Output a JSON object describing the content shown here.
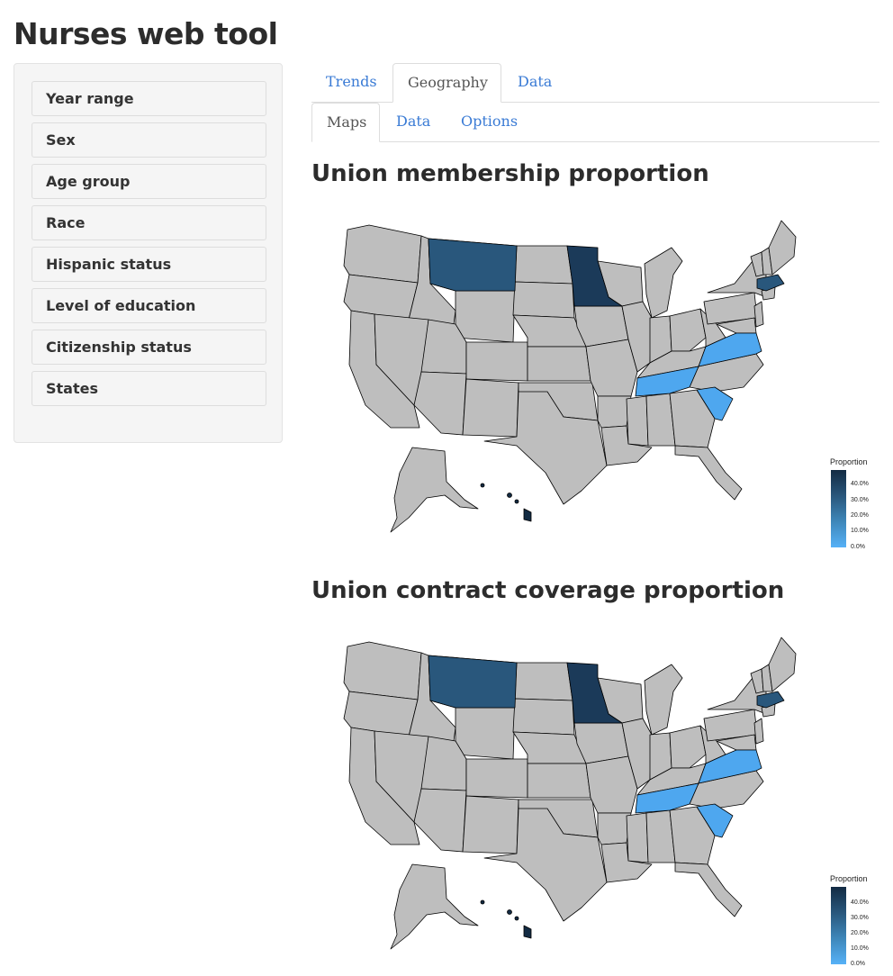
{
  "app": {
    "title": "Nurses web tool"
  },
  "sidebar": {
    "items": [
      {
        "label": "Year range"
      },
      {
        "label": "Sex"
      },
      {
        "label": "Age group"
      },
      {
        "label": "Race"
      },
      {
        "label": "Hispanic status"
      },
      {
        "label": "Level of education"
      },
      {
        "label": "Citizenship status"
      },
      {
        "label": "States"
      }
    ]
  },
  "main_tabs": [
    {
      "label": "Trends",
      "active": false
    },
    {
      "label": "Geography",
      "active": true
    },
    {
      "label": "Data",
      "active": false
    }
  ],
  "sub_tabs": [
    {
      "label": "Maps",
      "active": true
    },
    {
      "label": "Data",
      "active": false
    },
    {
      "label": "Options",
      "active": false
    }
  ],
  "colors": {
    "link": "#3a7bd5",
    "no_data": "#bebebe",
    "low": "#56b1f7",
    "high": "#132b43"
  },
  "maps": [
    {
      "title": "Union membership proportion",
      "legend": {
        "title": "Proportion",
        "ticks": [
          "40.0%",
          "30.0%",
          "20.0%",
          "10.0%",
          "0.0%"
        ]
      },
      "shaded_states": [
        {
          "state": "Minnesota",
          "level": "high"
        },
        {
          "state": "Hawaii",
          "level": "high"
        },
        {
          "state": "Montana",
          "level": "medium"
        },
        {
          "state": "Massachusetts",
          "level": "medium"
        },
        {
          "state": "Virginia",
          "level": "low"
        },
        {
          "state": "Tennessee",
          "level": "low"
        },
        {
          "state": "South Carolina",
          "level": "low"
        }
      ]
    },
    {
      "title": "Union contract coverage proportion",
      "legend": {
        "title": "Proportion",
        "ticks": [
          "40.0%",
          "30.0%",
          "20.0%",
          "10.0%",
          "0.0%"
        ]
      },
      "shaded_states": [
        {
          "state": "Minnesota",
          "level": "high"
        },
        {
          "state": "Hawaii",
          "level": "high"
        },
        {
          "state": "Montana",
          "level": "medium"
        },
        {
          "state": "Massachusetts",
          "level": "medium"
        },
        {
          "state": "Virginia",
          "level": "low"
        },
        {
          "state": "Tennessee",
          "level": "low"
        },
        {
          "state": "South Carolina",
          "level": "low"
        }
      ]
    }
  ]
}
